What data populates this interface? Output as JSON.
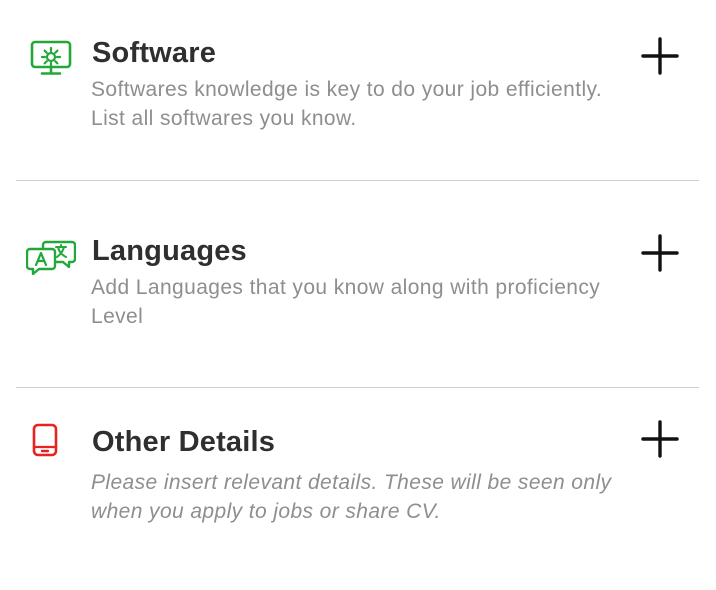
{
  "sections": [
    {
      "title": "Software",
      "description": "Softwares knowledge is key to do your job efficiently. List all softwares you know.",
      "icon": "monitor-gear-icon",
      "icon_color": "#22a838"
    },
    {
      "title": "Languages",
      "description": "Add Languages that you know along with proficiency Level",
      "icon": "translate-bubbles-icon",
      "icon_color": "#22a838"
    },
    {
      "title": "Other Details",
      "description": "Please insert relevant details. These will be seen only when you apply to jobs or share CV.",
      "icon": "mobile-phone-icon",
      "icon_color": "#e8231f"
    }
  ],
  "add_icon": "plus-icon",
  "divider_color": "#cfcfcf"
}
